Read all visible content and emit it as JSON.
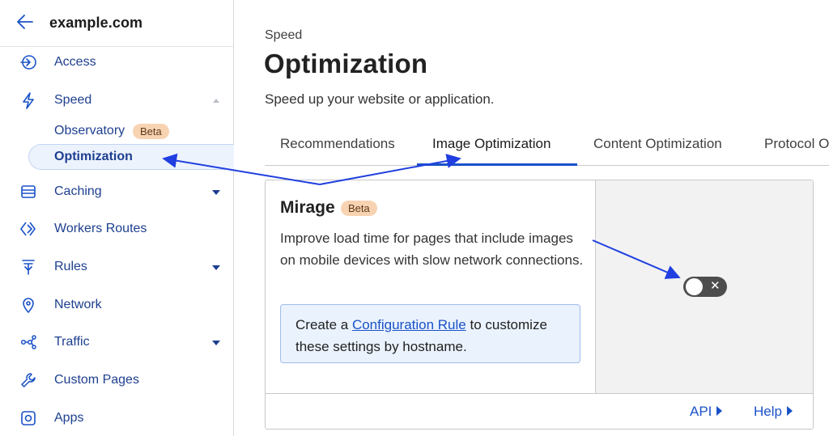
{
  "header": {
    "site": "example.com"
  },
  "sidebar": {
    "items": [
      {
        "label": "Access",
        "icon": "access-icon"
      },
      {
        "label": "Speed",
        "icon": "bolt-icon"
      },
      {
        "label": "Caching",
        "icon": "caching-icon"
      },
      {
        "label": "Workers Routes",
        "icon": "workers-icon"
      },
      {
        "label": "Rules",
        "icon": "rules-icon"
      },
      {
        "label": "Network",
        "icon": "location-pin-icon"
      },
      {
        "label": "Traffic",
        "icon": "traffic-icon"
      },
      {
        "label": "Custom Pages",
        "icon": "wrench-icon"
      },
      {
        "label": "Apps",
        "icon": "apps-icon"
      }
    ],
    "speed_sub": {
      "observatory": "Observatory",
      "observatory_badge": "Beta",
      "optimization": "Optimization"
    }
  },
  "main": {
    "crumb": "Speed",
    "title": "Optimization",
    "subtitle": "Speed up your website or application.",
    "tabs": [
      {
        "label": "Recommendations"
      },
      {
        "label": "Image Optimization"
      },
      {
        "label": "Content Optimization"
      },
      {
        "label": "Protocol O"
      }
    ],
    "active_tab": "Image Optimization",
    "card": {
      "title": "Mirage",
      "badge": "Beta",
      "description": "Improve load time for pages that include images on mobile devices with slow network connections.",
      "info_prefix": "Create a ",
      "info_link": "Configuration Rule",
      "info_suffix": " to customize these settings by hostname.",
      "toggle_state": "off",
      "toggle_off_glyph": "✕",
      "footer": {
        "api": "API",
        "help": "Help"
      }
    }
  },
  "colors": {
    "accent": "#1a52c8",
    "nav_text": "#1d3f8f",
    "beta_bg": "#f8d3b2",
    "active_bg": "#edf3fd",
    "info_bg": "#eaf2fd",
    "toggle_off": "#4d4d4d",
    "annotation": "#1f3fe0"
  }
}
